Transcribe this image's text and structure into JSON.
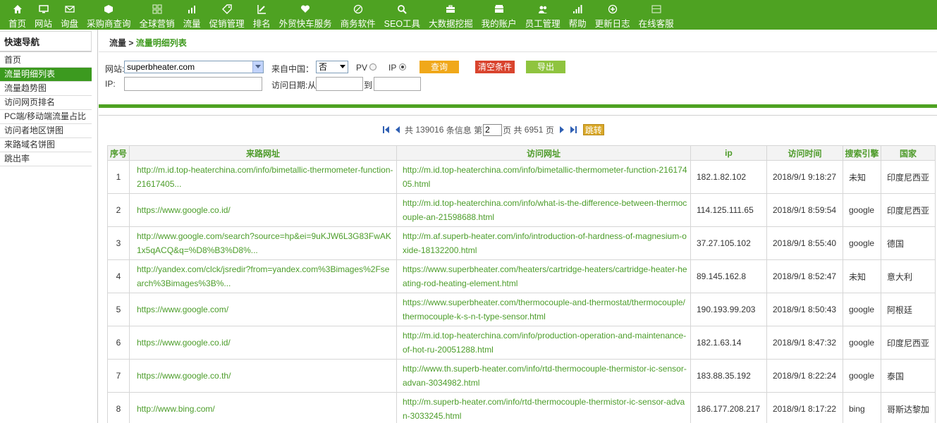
{
  "nav": [
    {
      "label": "首页",
      "icon": "home-icon"
    },
    {
      "label": "网站",
      "icon": "monitor-icon"
    },
    {
      "label": "询盘",
      "icon": "envelope-icon"
    },
    {
      "label": "采购商查询",
      "icon": "cube-icon"
    },
    {
      "label": "全球营销",
      "icon": "grid-icon"
    },
    {
      "label": "流量",
      "icon": "bar-chart-icon"
    },
    {
      "label": "促销管理",
      "icon": "tag-icon"
    },
    {
      "label": "排名",
      "icon": "edit-chart-icon"
    },
    {
      "label": "外贸快车服务",
      "icon": "heart-icon"
    },
    {
      "label": "商务软件",
      "icon": "leaf-icon"
    },
    {
      "label": "SEO工具",
      "icon": "search-icon"
    },
    {
      "label": "大数据挖掘",
      "icon": "briefcase-icon"
    },
    {
      "label": "我的账户",
      "icon": "wallet-icon"
    },
    {
      "label": "员工管理",
      "icon": "users-icon"
    },
    {
      "label": "帮助",
      "icon": "signal-icon"
    },
    {
      "label": "更新日志",
      "icon": "plus-circle-icon"
    },
    {
      "label": "在线客服",
      "icon": "window-icon"
    }
  ],
  "sidebar": {
    "title": "快速导航",
    "items": [
      "首页",
      "流量明细列表",
      "流量趋势图",
      "访问网页排名",
      "PC端/移动端流量占比",
      "访问者地区饼图",
      "来路域名饼图",
      "跳出率"
    ],
    "active_index": 1
  },
  "breadcrumb": {
    "root": "流量",
    "sep": " > ",
    "current": "流量明细列表"
  },
  "filters": {
    "site_label": "网站:",
    "site_value": "superbheater.com",
    "from_china_label": "来自中国：",
    "from_china_value": "否",
    "pv_label": "PV",
    "ip_label": "IP",
    "selected_mode": "IP",
    "query_button": "查询",
    "clear_button": "清空条件",
    "export_button": "导出",
    "ip_field_label": "IP:",
    "ip_value": "",
    "date_label": "访问日期:从",
    "date_from": "",
    "date_to_label": "到",
    "date_to": ""
  },
  "pager": {
    "text_total_prefix": "共",
    "total_records": "139016",
    "text_records_suffix": "条信息 第",
    "current_page": "2",
    "text_page": "页 共",
    "total_pages": "6951",
    "text_pages_suffix": "页",
    "jump_button": "跳转"
  },
  "table": {
    "headers": [
      "序号",
      "来路网址",
      "访问网址",
      "ip",
      "访问时间",
      "搜索引擎",
      "国家"
    ],
    "rows": [
      {
        "no": "1",
        "from": "http://m.id.top-heaterchina.com/info/bimetallic-thermometer-function-21617405...",
        "to": "http://m.id.top-heaterchina.com/info/bimetallic-thermometer-function-21617405.html",
        "ip": "182.1.82.102",
        "time": "2018/9/1 9:18:27",
        "engine": "未知",
        "country": "印度尼西亚"
      },
      {
        "no": "2",
        "from": "https://www.google.co.id/",
        "to": "http://m.id.top-heaterchina.com/info/what-is-the-difference-between-thermocouple-an-21598688.html",
        "ip": "114.125.111.65",
        "time": "2018/9/1 8:59:54",
        "engine": "google",
        "country": "印度尼西亚"
      },
      {
        "no": "3",
        "from": "http://www.google.com/search?source=hp&ei=9uKJW6L3G83FwAK1x5qACQ&q=%D8%B3%D8%...",
        "to": "http://m.af.superb-heater.com/info/introduction-of-hardness-of-magnesium-oxide-18132200.html",
        "ip": "37.27.105.102",
        "time": "2018/9/1 8:55:40",
        "engine": "google",
        "country": "德国"
      },
      {
        "no": "4",
        "from": "http://yandex.com/clck/jsredir?from=yandex.com%3Bimages%2Fsearch%3Bimages%3B%...",
        "to": "https://www.superbheater.com/heaters/cartridge-heaters/cartridge-heater-heating-rod-heating-element.html",
        "ip": "89.145.162.8",
        "time": "2018/9/1 8:52:47",
        "engine": "未知",
        "country": "意大利"
      },
      {
        "no": "5",
        "from": "https://www.google.com/",
        "to": "https://www.superbheater.com/thermocouple-and-thermostat/thermocouple/thermocouple-k-s-n-t-type-sensor.html",
        "ip": "190.193.99.203",
        "time": "2018/9/1 8:50:43",
        "engine": "google",
        "country": "阿根廷"
      },
      {
        "no": "6",
        "from": "https://www.google.co.id/",
        "to": "http://m.id.top-heaterchina.com/info/production-operation-and-maintenance-of-hot-ru-20051288.html",
        "ip": "182.1.63.14",
        "time": "2018/9/1 8:47:32",
        "engine": "google",
        "country": "印度尼西亚"
      },
      {
        "no": "7",
        "from": "https://www.google.co.th/",
        "to": "http://www.th.superb-heater.com/info/rtd-thermocouple-thermistor-ic-sensor-advan-3034982.html",
        "ip": "183.88.35.192",
        "time": "2018/9/1 8:22:24",
        "engine": "google",
        "country": "泰国"
      },
      {
        "no": "8",
        "from": "http://www.bing.com/",
        "to": "http://m.superb-heater.com/info/rtd-thermocouple-thermistor-ic-sensor-advan-3033245.html",
        "ip": "186.177.208.217",
        "time": "2018/9/1 8:17:22",
        "engine": "bing",
        "country": "哥斯达黎加"
      }
    ]
  },
  "colors": {
    "brand_green": "#4ea222",
    "active_green": "#3c9a1f",
    "link_green": "#4c9d2a",
    "query_orange": "#f0a81a",
    "clear_red": "#d9442e",
    "export_green": "#8fc43f"
  }
}
